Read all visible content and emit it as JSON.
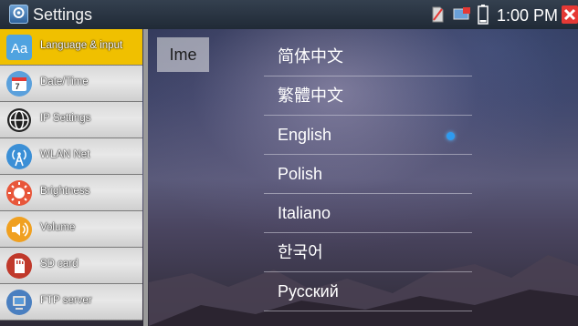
{
  "statusbar": {
    "title": "Settings",
    "time": "1:00 PM",
    "icons": [
      "settings-app-icon",
      "sd-card-icon",
      "screen-icon",
      "battery-icon",
      "close-icon"
    ]
  },
  "sidebar": {
    "items": [
      {
        "label": "Language & input",
        "icon": "language-icon",
        "active": true
      },
      {
        "label": "Date/Time",
        "icon": "calendar-icon",
        "active": false
      },
      {
        "label": "IP Settings",
        "icon": "globe-icon",
        "active": false
      },
      {
        "label": "WLAN Net",
        "icon": "wifi-antenna-icon",
        "active": false
      },
      {
        "label": "Brightness",
        "icon": "brightness-icon",
        "active": false
      },
      {
        "label": "Volume",
        "icon": "speaker-icon",
        "active": false
      },
      {
        "label": "SD card",
        "icon": "sd-card-icon",
        "active": false
      },
      {
        "label": "FTP server",
        "icon": "ftp-server-icon",
        "active": false
      }
    ]
  },
  "main": {
    "ime_label": "Ime",
    "languages": [
      {
        "label": "简体中文",
        "selected": false
      },
      {
        "label": "繁體中文",
        "selected": false
      },
      {
        "label": "English",
        "selected": true
      },
      {
        "label": "Polish",
        "selected": false
      },
      {
        "label": "Italiano",
        "selected": false
      },
      {
        "label": "한국어",
        "selected": false
      },
      {
        "label": "Русский",
        "selected": false
      }
    ]
  },
  "colors": {
    "active_item": "#f0c000",
    "selected_indicator": "#2e9bf0",
    "close_button": "#e53935"
  }
}
